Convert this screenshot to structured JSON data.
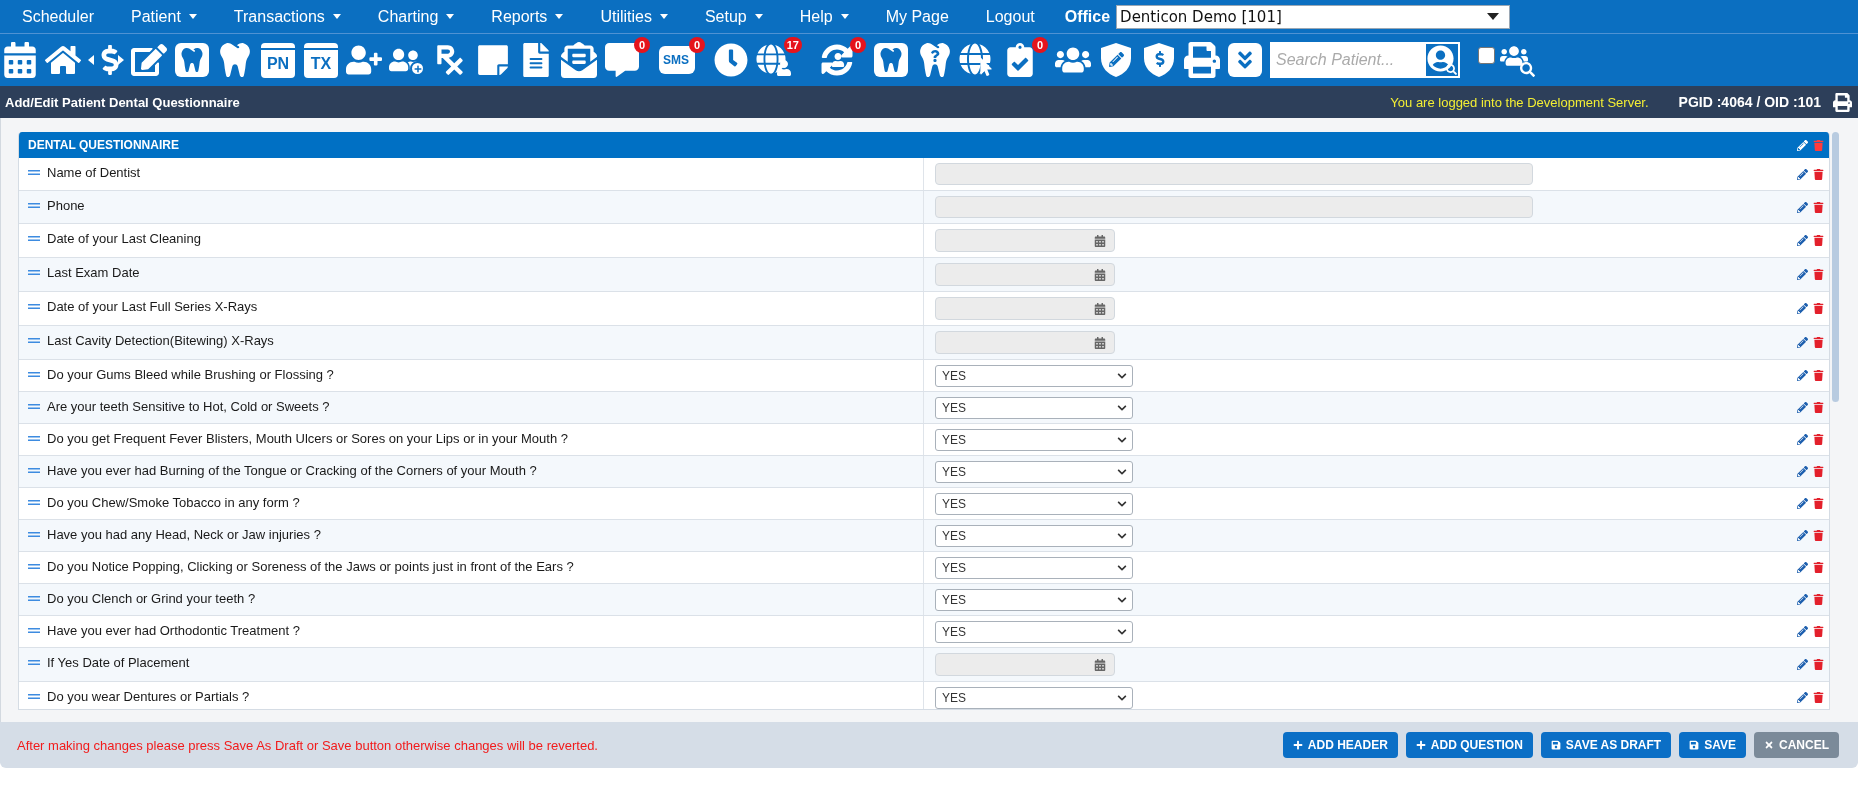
{
  "menu": [
    {
      "label": "Scheduler",
      "has_menu": false
    },
    {
      "label": "Patient",
      "has_menu": true
    },
    {
      "label": "Transactions",
      "has_menu": true
    },
    {
      "label": "Charting",
      "has_menu": true
    },
    {
      "label": "Reports",
      "has_menu": true
    },
    {
      "label": "Utilities",
      "has_menu": true
    },
    {
      "label": "Setup",
      "has_menu": true
    },
    {
      "label": "Help",
      "has_menu": true
    },
    {
      "label": "My Page",
      "has_menu": false
    },
    {
      "label": "Logout",
      "has_menu": false
    }
  ],
  "office": {
    "label": "Office",
    "value": "Denticon Demo [101]"
  },
  "toolbar": {
    "pn_label": "PN",
    "tx_label": "TX",
    "sms_label": "SMS",
    "chat_badge": "0",
    "sms_badge": "0",
    "web_badge": "17",
    "sync_badge": "0",
    "task_badge": "0",
    "search": {
      "placeholder": "Search Patient..."
    },
    "checkbox": {
      "checked": false
    }
  },
  "page_header": {
    "title": "Add/Edit Patient Dental Questionnaire",
    "notice": "You are logged into the Development Server.",
    "ids": "PGID :4064 / OID :101"
  },
  "questionnaire": {
    "title": "DENTAL QUESTIONNAIRE",
    "rows": [
      {
        "label": "Name of Dentist",
        "kind": "text"
      },
      {
        "label": "Phone",
        "kind": "text"
      },
      {
        "label": "Date of your Last Cleaning",
        "kind": "date"
      },
      {
        "label": "Last Exam Date",
        "kind": "date"
      },
      {
        "label": "Date of your Last Full Series X-Rays",
        "kind": "date"
      },
      {
        "label": "Last Cavity Detection(Bitewing) X-Rays",
        "kind": "date"
      },
      {
        "label": "Do your Gums Bleed while Brushing or Flossing ?",
        "kind": "select",
        "value": "YES"
      },
      {
        "label": "Are your teeth Sensitive to Hot, Cold or Sweets ?",
        "kind": "select",
        "value": "YES"
      },
      {
        "label": "Do you get Frequent Fever Blisters, Mouth Ulcers or Sores on your Lips or in your Mouth ?",
        "kind": "select",
        "value": "YES"
      },
      {
        "label": "Have you ever had Burning of the Tongue or Cracking of the Corners of your Mouth ?",
        "kind": "select",
        "value": "YES"
      },
      {
        "label": "Do you Chew/Smoke Tobacco in any form ?",
        "kind": "select",
        "value": "YES"
      },
      {
        "label": "Have you had any Head, Neck or Jaw injuries ?",
        "kind": "select",
        "value": "YES"
      },
      {
        "label": "Do you Notice Popping, Clicking or Soreness of the Jaws or points just in front of the Ears ?",
        "kind": "select",
        "value": "YES"
      },
      {
        "label": "Do you Clench or Grind your teeth ?",
        "kind": "select",
        "value": "YES"
      },
      {
        "label": "Have you ever had Orthodontic Treatment ?",
        "kind": "select",
        "value": "YES"
      },
      {
        "label": "If Yes Date of Placement",
        "kind": "date"
      },
      {
        "label": "Do you wear Dentures or Partials ?",
        "kind": "select",
        "value": "YES"
      }
    ]
  },
  "footer": {
    "message": "After making changes please press Save As Draft or Save button otherwise changes will be reverted.",
    "buttons": [
      {
        "label": "ADD HEADER",
        "kind": "add"
      },
      {
        "label": "ADD QUESTION",
        "kind": "add"
      },
      {
        "label": "SAVE AS DRAFT",
        "kind": "save"
      },
      {
        "label": "SAVE",
        "kind": "save"
      },
      {
        "label": "CANCEL",
        "kind": "cancel"
      }
    ]
  }
}
